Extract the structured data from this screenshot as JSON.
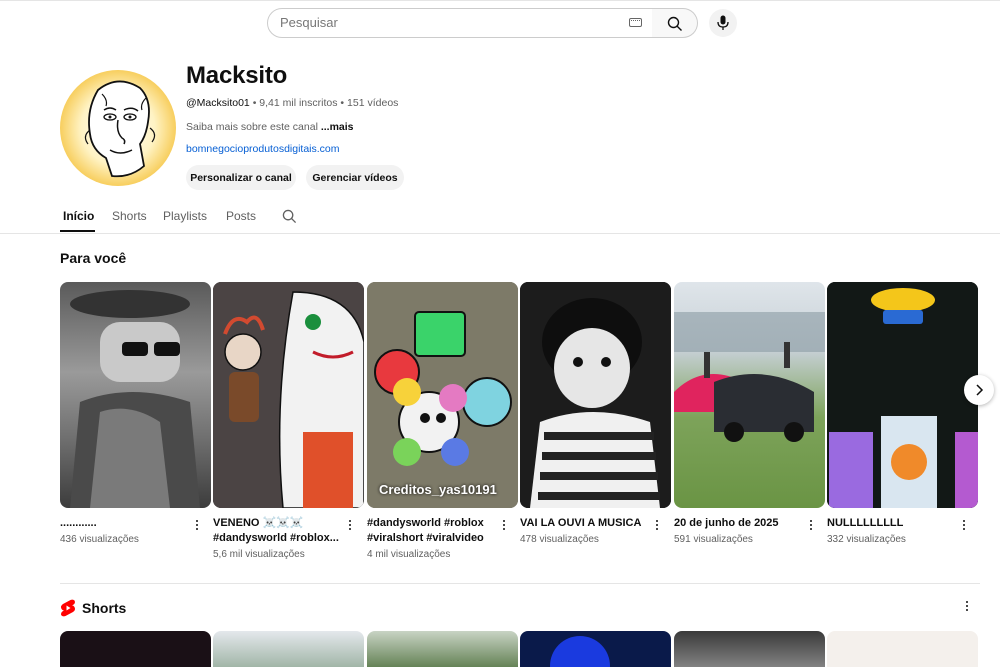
{
  "search": {
    "placeholder": "Pesquisar"
  },
  "channel": {
    "name": "Macksito",
    "handle": "@Macksito01",
    "subscribers": "9,41 mil inscritos",
    "video_count": "151 vídeos",
    "separator": "•",
    "description": "Saiba mais sobre este canal",
    "more_label": "...mais",
    "link": "bomnegocioprodutosdigitais.com",
    "customize_label": "Personalizar o canal",
    "manage_label": "Gerenciar vídeos"
  },
  "tabs": [
    {
      "label": "Início",
      "active": true
    },
    {
      "label": "Shorts",
      "active": false
    },
    {
      "label": "Playlists",
      "active": false
    },
    {
      "label": "Posts",
      "active": false
    }
  ],
  "for_you": {
    "title": "Para você",
    "videos": [
      {
        "title": "............",
        "views": "436 visualizações"
      },
      {
        "title": "VENENO ☠️☠️☠️ #dandysworld #roblox...",
        "views": "5,6 mil visualizações"
      },
      {
        "title": "#dandysworld #roblox #viralshort #viralvideo",
        "views": "4 mil visualizações",
        "overlay": "Creditos_yas10191"
      },
      {
        "title": "VAI LA OUVI A MUSICA",
        "views": "478 visualizações"
      },
      {
        "title": "20 de junho de 2025",
        "views": "591 visualizações"
      },
      {
        "title": "NULLLLLLLLL",
        "views": "332 visualizações"
      }
    ]
  },
  "shorts": {
    "title": "Shorts"
  },
  "colors": {
    "accent_red": "#ff0000",
    "link_blue": "#065fd4",
    "chip_bg": "#f2f2f2",
    "secondary_text": "#606060"
  },
  "icons": [
    "keyboard-icon",
    "search-icon",
    "mic-icon",
    "search-channel-icon",
    "more-vert-icon",
    "chevron-right-icon",
    "shorts-logo-icon"
  ]
}
